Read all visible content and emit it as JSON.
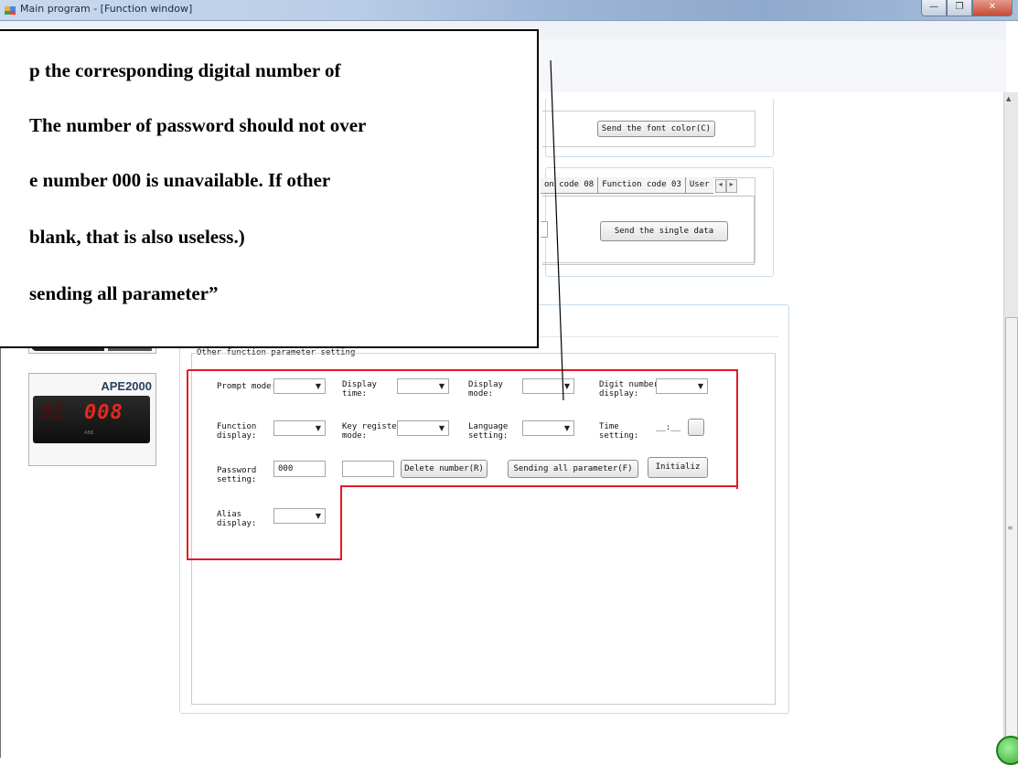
{
  "window": {
    "title": "Main program - [Function window]",
    "buttons": {
      "minimize": "—",
      "restore": "❐",
      "close": "✕"
    }
  },
  "callout": {
    "lines": [
      "p  the  corresponding  digital  number  of",
      "The  number  of  password  should  not  over",
      "e  number  000  is  unavailable.  If  other",
      "blank, that is also useless.)",
      "sending all parameter”"
    ]
  },
  "font_color": {
    "button": "Send the font color(C)"
  },
  "tabs": {
    "items": [
      "on code 08",
      "Function code 03",
      "User"
    ],
    "scroll_left": "◂",
    "scroll_right": "▸",
    "send_button": "Send the single data"
  },
  "device": {
    "model": "APE2000",
    "display_left": "01",
    "display_right": "008",
    "sub": "ABB"
  },
  "other": {
    "title": "Other function parameter setting",
    "prompt_mode": "Prompt mode:",
    "display_time": "Display\ntime:",
    "display_mode": "Display\nmode:",
    "digit_number_display": "Digit number\ndisplay:",
    "function_display": "Function\ndisplay:",
    "key_register_mode": "Key register\nmode:",
    "language_setting": "Language\nsetting:",
    "time_setting": "Time\nsetting:",
    "time_value": "__:__",
    "password_setting": "Password\nsetting:",
    "password_value": "000",
    "delete_number": "Delete number(R)",
    "sending_all": "Sending all parameter(F)",
    "initialize": "Initializ",
    "alias_display": "Alias\ndisplay:"
  },
  "colors": {
    "highlight": "#e01b24",
    "callout_border": "#000000",
    "card_border": "#c9dcea"
  }
}
